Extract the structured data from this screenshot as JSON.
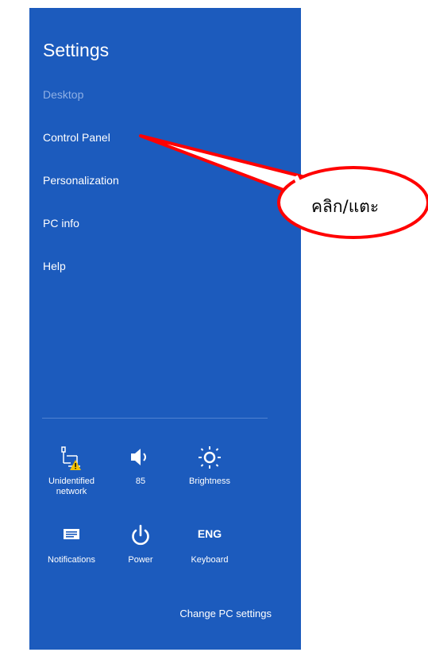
{
  "settings": {
    "title": "Settings",
    "items": [
      {
        "label": "Desktop",
        "dimmed": true
      },
      {
        "label": "Control Panel",
        "dimmed": false
      },
      {
        "label": "Personalization",
        "dimmed": false
      },
      {
        "label": "PC info",
        "dimmed": false
      },
      {
        "label": "Help",
        "dimmed": false
      }
    ]
  },
  "quick_settings": {
    "network": {
      "label": "Unidentified\nnetwork",
      "icon": "network-warning-icon"
    },
    "volume": {
      "label": "85",
      "icon": "speaker-icon"
    },
    "brightness": {
      "label": "Brightness",
      "icon": "sun-icon"
    },
    "notifications": {
      "label": "Notifications",
      "icon": "notifications-icon"
    },
    "power": {
      "label": "Power",
      "icon": "power-icon"
    },
    "keyboard": {
      "label": "Keyboard",
      "glyph": "ENG",
      "icon": "keyboard-language-icon"
    }
  },
  "change_pc_settings": "Change PC settings",
  "callout": {
    "text": "คลิก/แตะ",
    "color": "#ff0000"
  },
  "colors": {
    "panel_background": "#1c5bbd",
    "warning": "#f2c200"
  }
}
